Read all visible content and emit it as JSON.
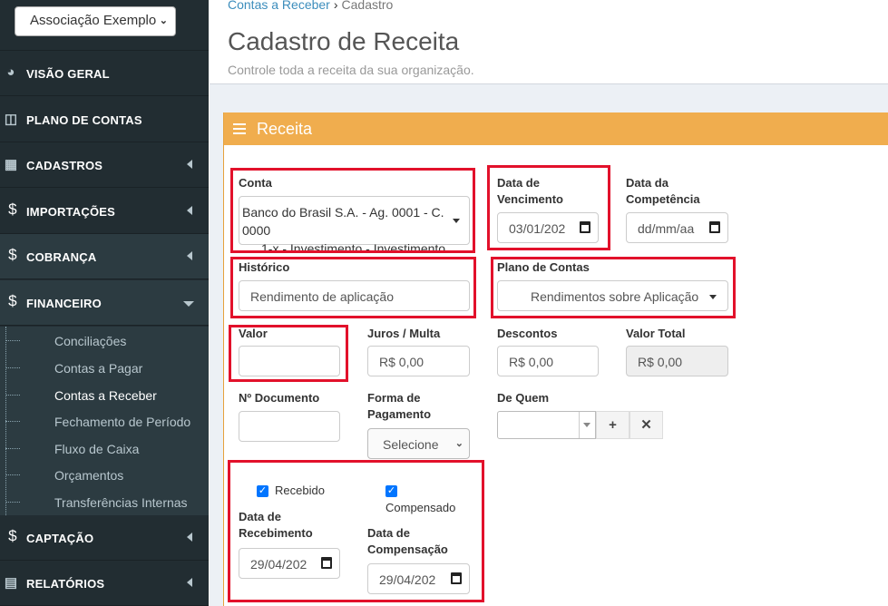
{
  "sidebar": {
    "org_select": "Associação Exemplo",
    "items": [
      {
        "label": "VISÃO GERAL",
        "icon": "dashboard-icon"
      },
      {
        "label": "PLANO DE CONTAS",
        "icon": "book-icon"
      },
      {
        "label": "CADASTROS",
        "icon": "table-icon"
      },
      {
        "label": "IMPORTAÇÕES",
        "icon": "dollar-icon"
      },
      {
        "label": "COBRANÇA",
        "icon": "dollar-icon"
      },
      {
        "label": "FINANCEIRO",
        "icon": "dollar-icon"
      },
      {
        "label": "CAPTAÇÃO",
        "icon": "dollar-icon"
      },
      {
        "label": "RELATÓRIOS",
        "icon": "bar-chart-icon"
      }
    ],
    "submenu": [
      "Conciliações",
      "Contas a Pagar",
      "Contas a Receber",
      "Fechamento de Período",
      "Fluxo de Caixa",
      "Orçamentos",
      "Transferências Internas"
    ]
  },
  "breadcrumb": {
    "parent": "Contas a Receber",
    "separator": "›",
    "current": "Cadastro"
  },
  "page": {
    "title": "Cadastro de Receita",
    "subtitle": "Controle toda a receita da sua organização."
  },
  "box": {
    "title": "Receita"
  },
  "form": {
    "conta": {
      "label": "Conta",
      "value_line1": "Banco do Brasil S.A. - Ag. 0001 - C. 0000",
      "value_line2": "1-x - Investimento - Investimento"
    },
    "vencimento": {
      "label_line1": "Data de",
      "label_line2": "Vencimento",
      "value": "03/01/202"
    },
    "competencia": {
      "label_line1": "Data da",
      "label_line2": "Competência",
      "placeholder": "dd/mm/aa"
    },
    "historico": {
      "label": "Histórico",
      "value": "Rendimento de aplicação"
    },
    "plano": {
      "label": "Plano de Contas",
      "value": "Rendimentos sobre Aplicação"
    },
    "valor": {
      "label": "Valor",
      "value": ""
    },
    "juros": {
      "label": "Juros / Multa",
      "value": "R$ 0,00"
    },
    "descontos": {
      "label": "Descontos",
      "value": "R$ 0,00"
    },
    "valor_total": {
      "label": "Valor Total",
      "value": "R$ 0,00"
    },
    "documento": {
      "label": "Nº Documento",
      "value": ""
    },
    "forma_pagamento": {
      "label_line1": "Forma de",
      "label_line2": "Pagamento",
      "value": "Selecione"
    },
    "de_quem": {
      "label": "De Quem",
      "add": "+",
      "remove": "✕"
    },
    "recebido": {
      "label": "Recebido",
      "checked": true
    },
    "compensado": {
      "label": "Compensado",
      "checked": true
    },
    "data_recebimento": {
      "label_line1": "Data de",
      "label_line2": "Recebimento",
      "value": "29/04/202"
    },
    "data_compensacao": {
      "label_line1": "Data de",
      "label_line2": "Compensação",
      "value": "29/04/202"
    }
  },
  "colors": {
    "sidebar": "#222d32",
    "accent": "#f0ad4e",
    "highlight": "#e2112b",
    "link": "#3c8dbc"
  }
}
